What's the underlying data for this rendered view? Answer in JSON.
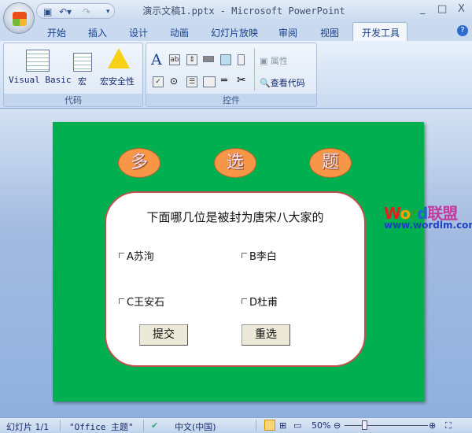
{
  "window": {
    "title": "演示文稿1.pptx - Microsoft PowerPoint",
    "minimize": "_",
    "maximize": "□",
    "close": "X"
  },
  "tabs": [
    "开始",
    "插入",
    "设计",
    "动画",
    "幻灯片放映",
    "审阅",
    "视图",
    "开发工具"
  ],
  "ribbon": {
    "code_group": {
      "label": "代码",
      "visual_basic": "Visual Basic",
      "macro": "宏",
      "macro_security": "宏安全性"
    },
    "controls_group": {
      "label": "控件",
      "properties": "属性",
      "view_code": "查看代码"
    }
  },
  "slide": {
    "ovals": [
      "多",
      "选",
      "题"
    ],
    "question": "下面哪几位是被封为唐宋八大家的",
    "options": [
      "A苏洵",
      "B李白",
      "C王安石",
      "D杜甫"
    ],
    "submit": "提交",
    "reset": "重选"
  },
  "watermark": {
    "word_w": "W",
    "word_o": "o",
    "word_r": "r",
    "word_d": "d",
    "cn": "联盟",
    "url": "www.wordlm.com"
  },
  "status": {
    "slide": "幻灯片 1/1",
    "theme": "\"Office 主题\"",
    "language": "中文(中国)",
    "zoom": "50%",
    "zoom_percent": 50
  }
}
